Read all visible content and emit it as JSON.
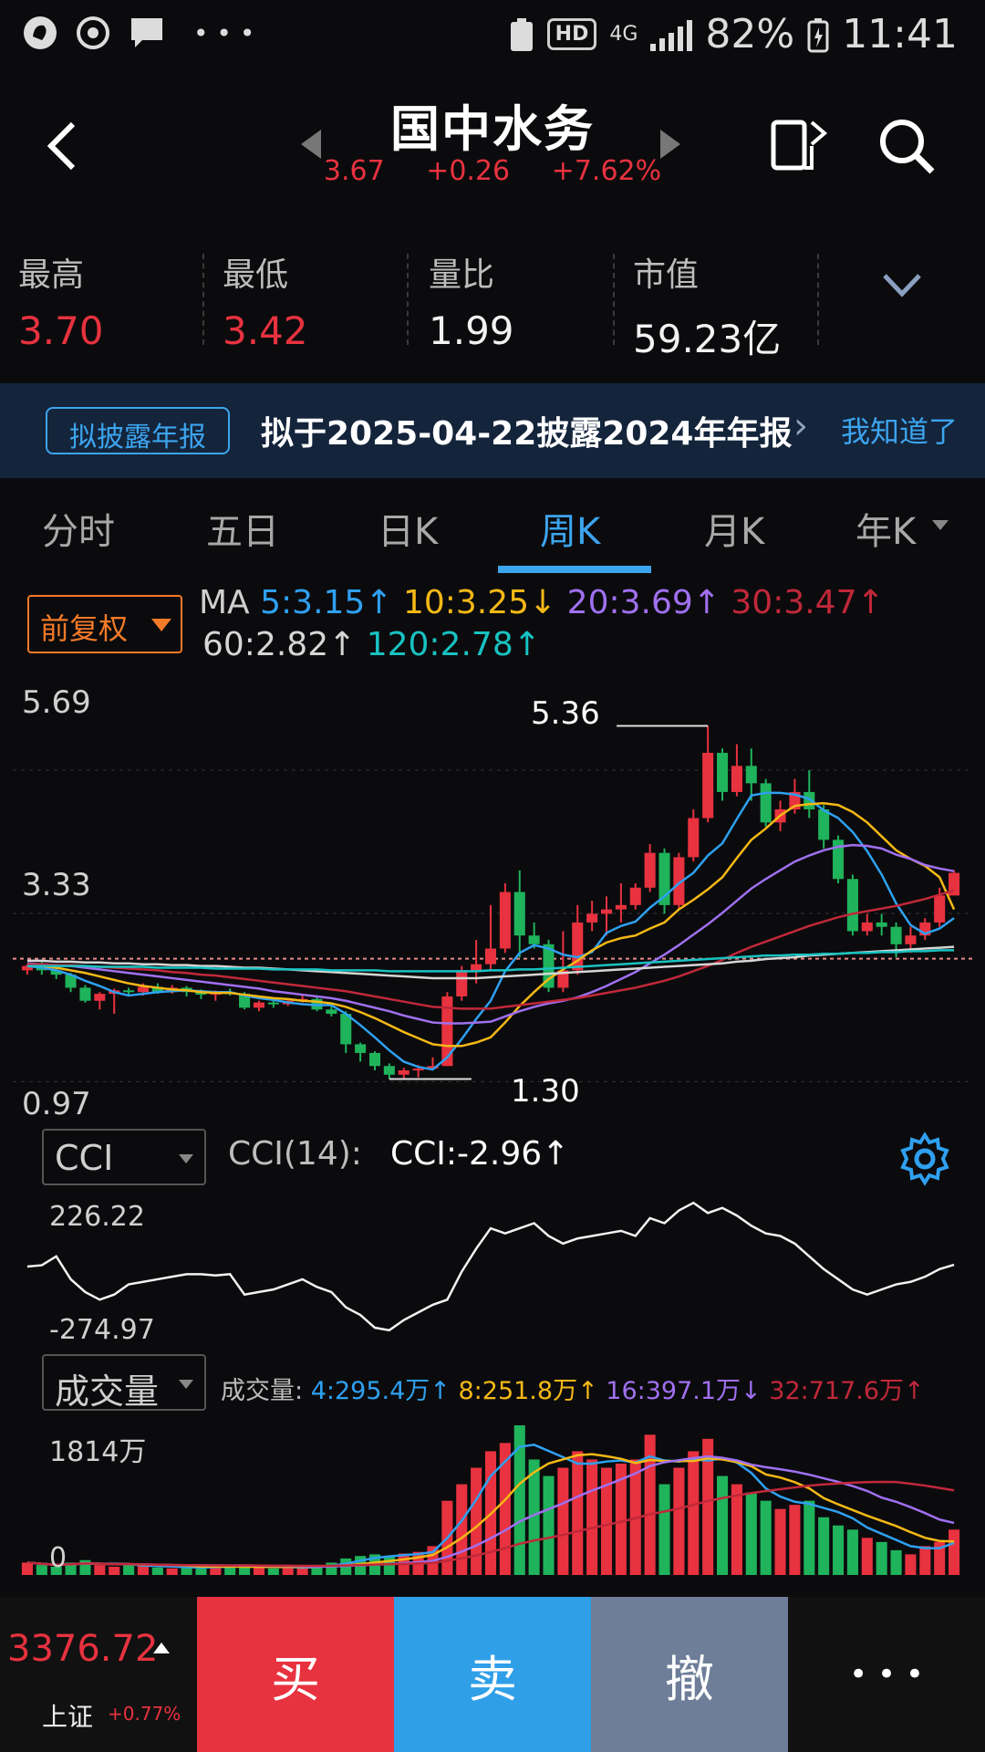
{
  "status_bar": {
    "network": "4G",
    "hd": "HD",
    "battery": "82%",
    "time": "11:41"
  },
  "header": {
    "stock_name": "国中水务",
    "price": "3.67",
    "change": "+0.26",
    "change_pct": "+7.62%"
  },
  "stats": [
    {
      "label": "最高",
      "value": "3.70",
      "color": "#e8323f"
    },
    {
      "label": "最低",
      "value": "3.42",
      "color": "#e8323f"
    },
    {
      "label": "量比",
      "value": "1.99",
      "color": "#f2f2f2"
    },
    {
      "label": "市值",
      "value": "59.23亿",
      "color": "#f2f2f2"
    }
  ],
  "notice": {
    "tag": "拟披露年报",
    "text": "拟于2025-04-22披露2024年年报",
    "action": "我知道了"
  },
  "tabs": [
    {
      "label": "分时",
      "active": false
    },
    {
      "label": "五日",
      "active": false
    },
    {
      "label": "日K",
      "active": false
    },
    {
      "label": "周K",
      "active": true
    },
    {
      "label": "月K",
      "active": false
    },
    {
      "label": "年K",
      "active": false
    }
  ],
  "kline_header": {
    "adjust_label": "前复权",
    "ma_title": "MA",
    "ma": [
      {
        "text": "5:3.15",
        "arrow": "↑",
        "color": "#2fa0f0"
      },
      {
        "text": "10:3.25",
        "arrow": "↓",
        "color": "#f5b816"
      },
      {
        "text": "20:3.69",
        "arrow": "↑",
        "color": "#a070f0"
      },
      {
        "text": "30:3.47",
        "arrow": "↑",
        "color": "#c0283a"
      },
      {
        "text": "60:2.82",
        "arrow": "↑",
        "color": "#d6d6d6"
      },
      {
        "text": "120:2.78",
        "arrow": "↑",
        "color": "#19c2c2"
      }
    ]
  },
  "kline": {
    "y_top": "5.69",
    "y_mid": "3.33",
    "y_bottom": "0.97",
    "high_marker": "5.36",
    "low_marker": "1.30"
  },
  "cci": {
    "selector": "CCI",
    "label": "CCI(14):",
    "value": "CCI:-2.96↑",
    "y_top": "226.22",
    "y_bottom": "-274.97"
  },
  "volume": {
    "selector": "成交量",
    "label": "成交量:",
    "ma": [
      {
        "text": "4:295.4万↑",
        "color": "#2fa0f0"
      },
      {
        "text": "8:251.8万↑",
        "color": "#f5b816"
      },
      {
        "text": "16:397.1万↓",
        "color": "#a070f0"
      },
      {
        "text": "32:717.6万↑",
        "color": "#c0283a"
      }
    ],
    "y_top": "1814万",
    "y_bottom": "0"
  },
  "bottom_bar": {
    "index_value": "3376.72",
    "index_name": "上证",
    "index_pct": "+0.77%",
    "buy": "买",
    "sell": "卖",
    "cancel": "撤",
    "more": "• • •"
  },
  "chart_data": {
    "type": "candlestick",
    "candles": [
      [
        2.55,
        2.6,
        2.5,
        2.62
      ],
      [
        2.6,
        2.55,
        2.5,
        2.65
      ],
      [
        2.55,
        2.5,
        2.45,
        2.6
      ],
      [
        2.5,
        2.35,
        2.3,
        2.52
      ],
      [
        2.35,
        2.2,
        2.18,
        2.38
      ],
      [
        2.2,
        2.28,
        2.1,
        2.3
      ],
      [
        2.28,
        2.32,
        2.05,
        2.34
      ],
      [
        2.32,
        2.3,
        2.25,
        2.35
      ],
      [
        2.3,
        2.36,
        2.26,
        2.4
      ],
      [
        2.36,
        2.3,
        2.28,
        2.4
      ],
      [
        2.3,
        2.35,
        2.28,
        2.38
      ],
      [
        2.35,
        2.3,
        2.25,
        2.37
      ],
      [
        2.3,
        2.27,
        2.22,
        2.33
      ],
      [
        2.27,
        2.3,
        2.2,
        2.32
      ],
      [
        2.3,
        2.28,
        2.26,
        2.34
      ],
      [
        2.28,
        2.12,
        2.1,
        2.3
      ],
      [
        2.12,
        2.18,
        2.08,
        2.2
      ],
      [
        2.18,
        2.16,
        2.12,
        2.2
      ],
      [
        2.16,
        2.2,
        2.14,
        2.22
      ],
      [
        2.2,
        2.22,
        2.18,
        2.26
      ],
      [
        2.22,
        2.1,
        2.08,
        2.25
      ],
      [
        2.1,
        2.05,
        2.02,
        2.15
      ],
      [
        2.05,
        1.7,
        1.6,
        2.08
      ],
      [
        1.7,
        1.6,
        1.5,
        1.72
      ],
      [
        1.6,
        1.45,
        1.4,
        1.62
      ],
      [
        1.45,
        1.35,
        1.3,
        1.48
      ],
      [
        1.35,
        1.4,
        1.3,
        1.43
      ],
      [
        1.4,
        1.42,
        1.32,
        1.46
      ],
      [
        1.42,
        1.45,
        1.4,
        1.55
      ],
      [
        1.45,
        2.25,
        1.45,
        2.3
      ],
      [
        2.25,
        2.55,
        2.2,
        2.6
      ],
      [
        2.55,
        2.62,
        2.4,
        2.9
      ],
      [
        2.62,
        2.8,
        2.55,
        3.3
      ],
      [
        2.8,
        3.45,
        2.75,
        3.55
      ],
      [
        3.45,
        2.95,
        2.7,
        3.7
      ],
      [
        2.95,
        2.85,
        2.8,
        3.1
      ],
      [
        2.85,
        2.35,
        2.3,
        2.9
      ],
      [
        2.35,
        2.55,
        2.3,
        3.0
      ],
      [
        2.55,
        3.1,
        2.5,
        3.3
      ],
      [
        3.1,
        3.2,
        3.0,
        3.35
      ],
      [
        3.2,
        3.25,
        2.95,
        3.4
      ],
      [
        3.25,
        3.3,
        3.1,
        3.55
      ],
      [
        3.3,
        3.5,
        3.25,
        3.55
      ],
      [
        3.5,
        3.9,
        3.45,
        4.0
      ],
      [
        3.9,
        3.3,
        3.2,
        3.95
      ],
      [
        3.3,
        3.85,
        3.25,
        3.9
      ],
      [
        3.85,
        4.3,
        3.8,
        4.4
      ],
      [
        4.3,
        5.05,
        4.25,
        5.36
      ],
      [
        5.05,
        4.6,
        4.5,
        5.1
      ],
      [
        4.6,
        4.9,
        4.55,
        5.15
      ],
      [
        4.9,
        4.7,
        4.5,
        5.1
      ],
      [
        4.7,
        4.25,
        4.2,
        4.75
      ],
      [
        4.25,
        4.4,
        4.15,
        4.5
      ],
      [
        4.4,
        4.6,
        4.35,
        4.75
      ],
      [
        4.6,
        4.4,
        4.3,
        4.85
      ],
      [
        4.4,
        4.05,
        3.95,
        4.45
      ],
      [
        4.05,
        3.6,
        3.55,
        4.1
      ],
      [
        3.6,
        3.0,
        2.95,
        3.65
      ],
      [
        3.0,
        3.1,
        2.95,
        3.2
      ],
      [
        3.1,
        3.05,
        2.95,
        3.2
      ],
      [
        3.05,
        2.85,
        2.7,
        3.1
      ],
      [
        2.85,
        2.95,
        2.75,
        3.05
      ],
      [
        2.95,
        3.1,
        2.9,
        3.15
      ],
      [
        3.1,
        3.41,
        3.05,
        3.5
      ],
      [
        3.41,
        3.67,
        3.42,
        3.7
      ]
    ],
    "ma": {
      "MA5": [
        2.6,
        2.58,
        2.55,
        2.5,
        2.43,
        2.37,
        2.3,
        2.26,
        2.28,
        2.3,
        2.31,
        2.32,
        2.31,
        2.3,
        2.3,
        2.26,
        2.23,
        2.21,
        2.18,
        2.16,
        2.15,
        2.15,
        2.05,
        1.92,
        1.78,
        1.63,
        1.5,
        1.44,
        1.41,
        1.55,
        1.76,
        1.99,
        2.2,
        2.54,
        2.75,
        2.84,
        2.8,
        2.73,
        2.7,
        2.76,
        2.98,
        3.06,
        3.11,
        3.27,
        3.4,
        3.55,
        3.67,
        3.87,
        4.01,
        4.29,
        4.56,
        4.59,
        4.59,
        4.57,
        4.52,
        4.39,
        4.3,
        4.14,
        3.92,
        3.65,
        3.32,
        3.07,
        2.97,
        3.03,
        3.15
      ],
      "MA10": [
        2.62,
        2.6,
        2.58,
        2.55,
        2.52,
        2.48,
        2.44,
        2.4,
        2.37,
        2.35,
        2.33,
        2.32,
        2.3,
        2.29,
        2.29,
        2.27,
        2.25,
        2.23,
        2.22,
        2.2,
        2.19,
        2.17,
        2.13,
        2.07,
        2.0,
        1.92,
        1.84,
        1.77,
        1.7,
        1.68,
        1.68,
        1.72,
        1.78,
        1.95,
        2.14,
        2.3,
        2.45,
        2.56,
        2.66,
        2.78,
        2.87,
        2.92,
        2.95,
        3.03,
        3.1,
        3.25,
        3.36,
        3.48,
        3.62,
        3.84,
        4.05,
        4.18,
        4.33,
        4.44,
        4.46,
        4.47,
        4.45,
        4.37,
        4.25,
        4.09,
        3.93,
        3.83,
        3.75,
        3.62,
        3.25
      ],
      "MA20": [
        2.63,
        2.62,
        2.61,
        2.6,
        2.58,
        2.56,
        2.54,
        2.52,
        2.5,
        2.48,
        2.46,
        2.44,
        2.42,
        2.4,
        2.38,
        2.36,
        2.34,
        2.31,
        2.29,
        2.27,
        2.25,
        2.23,
        2.2,
        2.16,
        2.12,
        2.08,
        2.03,
        1.99,
        1.95,
        1.94,
        1.94,
        1.95,
        1.96,
        2.02,
        2.08,
        2.13,
        2.17,
        2.2,
        2.24,
        2.3,
        2.37,
        2.45,
        2.53,
        2.63,
        2.73,
        2.84,
        2.96,
        3.08,
        3.21,
        3.35,
        3.49,
        3.6,
        3.7,
        3.8,
        3.87,
        3.93,
        3.97,
        3.99,
        3.98,
        3.95,
        3.88,
        3.83,
        3.76,
        3.72,
        3.69
      ],
      "MA30": [
        2.62,
        2.62,
        2.61,
        2.61,
        2.6,
        2.59,
        2.58,
        2.57,
        2.56,
        2.55,
        2.53,
        2.52,
        2.5,
        2.49,
        2.47,
        2.45,
        2.43,
        2.41,
        2.39,
        2.37,
        2.35,
        2.33,
        2.31,
        2.28,
        2.25,
        2.22,
        2.19,
        2.16,
        2.13,
        2.12,
        2.11,
        2.11,
        2.11,
        2.13,
        2.15,
        2.17,
        2.19,
        2.21,
        2.23,
        2.26,
        2.29,
        2.32,
        2.35,
        2.39,
        2.43,
        2.48,
        2.54,
        2.6,
        2.67,
        2.75,
        2.82,
        2.88,
        2.94,
        3.0,
        3.06,
        3.11,
        3.16,
        3.2,
        3.23,
        3.26,
        3.29,
        3.33,
        3.37,
        3.42,
        3.47
      ],
      "MA60": [
        2.66,
        2.66,
        2.65,
        2.65,
        2.64,
        2.64,
        2.63,
        2.63,
        2.62,
        2.62,
        2.61,
        2.61,
        2.6,
        2.6,
        2.59,
        2.58,
        2.58,
        2.57,
        2.56,
        2.55,
        2.54,
        2.53,
        2.52,
        2.51,
        2.5,
        2.49,
        2.48,
        2.47,
        2.46,
        2.46,
        2.46,
        2.46,
        2.47,
        2.48,
        2.49,
        2.5,
        2.51,
        2.52,
        2.53,
        2.54,
        2.55,
        2.56,
        2.57,
        2.58,
        2.59,
        2.6,
        2.61,
        2.62,
        2.63,
        2.65,
        2.66,
        2.68,
        2.69,
        2.7,
        2.72,
        2.73,
        2.74,
        2.75,
        2.76,
        2.77,
        2.78,
        2.79,
        2.8,
        2.81,
        2.82
      ],
      "MA120": [
        2.6,
        2.6,
        2.6,
        2.6,
        2.6,
        2.59,
        2.59,
        2.59,
        2.59,
        2.58,
        2.58,
        2.58,
        2.58,
        2.57,
        2.57,
        2.57,
        2.57,
        2.56,
        2.56,
        2.56,
        2.56,
        2.55,
        2.55,
        2.55,
        2.55,
        2.54,
        2.54,
        2.54,
        2.54,
        2.54,
        2.54,
        2.54,
        2.55,
        2.55,
        2.56,
        2.56,
        2.57,
        2.58,
        2.59,
        2.6,
        2.61,
        2.62,
        2.63,
        2.64,
        2.65,
        2.66,
        2.67,
        2.68,
        2.69,
        2.7,
        2.71,
        2.72,
        2.72,
        2.73,
        2.73,
        2.74,
        2.74,
        2.75,
        2.75,
        2.76,
        2.76,
        2.77,
        2.77,
        2.78,
        2.78
      ]
    },
    "ylim": [
      0.97,
      5.69
    ],
    "cci": [
      -10,
      -5,
      30,
      -60,
      -110,
      -140,
      -120,
      -80,
      -70,
      -60,
      -50,
      -40,
      -40,
      -45,
      -40,
      -120,
      -110,
      -100,
      -80,
      -60,
      -90,
      -110,
      -170,
      -200,
      -250,
      -260,
      -220,
      -190,
      -160,
      -140,
      -30,
      60,
      140,
      120,
      140,
      160,
      110,
      80,
      100,
      110,
      120,
      130,
      110,
      180,
      160,
      210,
      240,
      200,
      220,
      190,
      150,
      120,
      110,
      80,
      30,
      -20,
      -60,
      -100,
      -120,
      -100,
      -80,
      -70,
      -50,
      -20,
      -2.96
    ],
    "cci_ylim": [
      -274.97,
      226.22
    ],
    "volume": [
      150,
      120,
      100,
      150,
      180,
      120,
      100,
      130,
      110,
      90,
      80,
      100,
      90,
      110,
      100,
      120,
      90,
      80,
      100,
      90,
      110,
      150,
      200,
      230,
      250,
      220,
      260,
      280,
      350,
      900,
      1100,
      1300,
      1500,
      1600,
      1814,
      1400,
      1200,
      1300,
      1500,
      1400,
      1300,
      1350,
      1400,
      1700,
      1100,
      1300,
      1500,
      1650,
      1200,
      1100,
      1000,
      900,
      800,
      850,
      900,
      700,
      600,
      550,
      450,
      400,
      300,
      250,
      350,
      400,
      550
    ],
    "volume_ylim": [
      0,
      1814
    ]
  }
}
